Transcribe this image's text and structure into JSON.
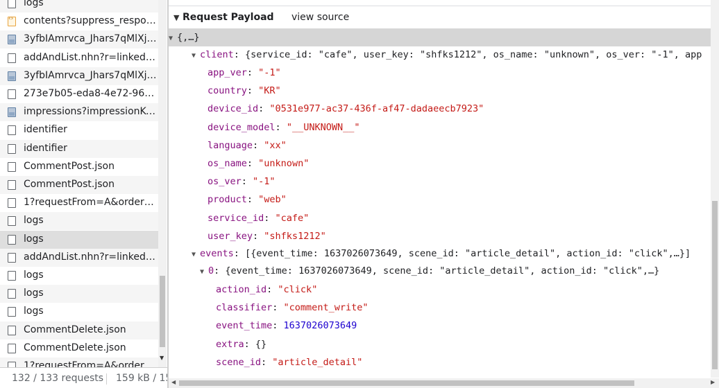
{
  "requests": [
    {
      "name": "logs",
      "icon": "doc"
    },
    {
      "name": "contents?suppress_respon…",
      "icon": "xml"
    },
    {
      "name": "3yfbIAmrvca_Jhars7qMlXj3…",
      "icon": "img"
    },
    {
      "name": "addAndList.nhn?r=linkedM…",
      "icon": "doc"
    },
    {
      "name": "3yfbIAmrvca_Jhars7qMlXj3…",
      "icon": "img"
    },
    {
      "name": "273e7b05-eda8-4e72-96e6…",
      "icon": "doc"
    },
    {
      "name": "impressions?impressionKe…",
      "icon": "img"
    },
    {
      "name": "identifier",
      "icon": "doc"
    },
    {
      "name": "identifier",
      "icon": "doc"
    },
    {
      "name": "CommentPost.json",
      "icon": "doc"
    },
    {
      "name": "CommentPost.json",
      "icon": "doc"
    },
    {
      "name": "1?requestFrom=A&orderBy…",
      "icon": "doc"
    },
    {
      "name": "logs",
      "icon": "doc"
    },
    {
      "name": "logs",
      "icon": "doc",
      "selected": true
    },
    {
      "name": "addAndList.nhn?r=linkedM…",
      "icon": "doc"
    },
    {
      "name": "logs",
      "icon": "doc"
    },
    {
      "name": "logs",
      "icon": "doc"
    },
    {
      "name": "logs",
      "icon": "doc"
    },
    {
      "name": "CommentDelete.json",
      "icon": "doc"
    },
    {
      "name": "CommentDelete.json",
      "icon": "doc"
    },
    {
      "name": "1?requestFrom=A&orderBy…",
      "icon": "doc"
    }
  ],
  "status": {
    "requests": "132 / 133 requests",
    "size": "159 kB / 15"
  },
  "payload": {
    "section_title": "Request Payload",
    "view_source": "view source",
    "root": "{,…}",
    "client_key": "client",
    "client_summary": "{service_id: \"cafe\", user_key: \"shfks1212\", os_name: \"unknown\", os_ver: \"-1\", app",
    "client_fields": [
      {
        "key": "app_ver",
        "value": "\"-1\""
      },
      {
        "key": "country",
        "value": "\"KR\""
      },
      {
        "key": "device_id",
        "value": "\"0531e977-ac37-436f-af47-dadaeecb7923\""
      },
      {
        "key": "device_model",
        "value": "\"__UNKNOWN__\""
      },
      {
        "key": "language",
        "value": "\"xx\""
      },
      {
        "key": "os_name",
        "value": "\"unknown\""
      },
      {
        "key": "os_ver",
        "value": "\"-1\""
      },
      {
        "key": "product",
        "value": "\"web\""
      },
      {
        "key": "service_id",
        "value": "\"cafe\""
      },
      {
        "key": "user_key",
        "value": "\"shfks1212\""
      }
    ],
    "events_key": "events",
    "events_summary": "[{event_time: 1637026073649, scene_id: \"article_detail\", action_id: \"click\",…}]",
    "event0_key": "0",
    "event0_summary": "{event_time: 1637026073649, scene_id: \"article_detail\", action_id: \"click\",…}",
    "event0_fields": [
      {
        "key": "action_id",
        "value": "\"click\"",
        "type": "string"
      },
      {
        "key": "classifier",
        "value": "\"comment_write\"",
        "type": "string"
      },
      {
        "key": "event_time",
        "value": "1637026073649",
        "type": "number"
      },
      {
        "key": "extra",
        "value": "{}",
        "type": "plain"
      },
      {
        "key": "scene_id",
        "value": "\"article_detail\"",
        "type": "string"
      }
    ]
  }
}
